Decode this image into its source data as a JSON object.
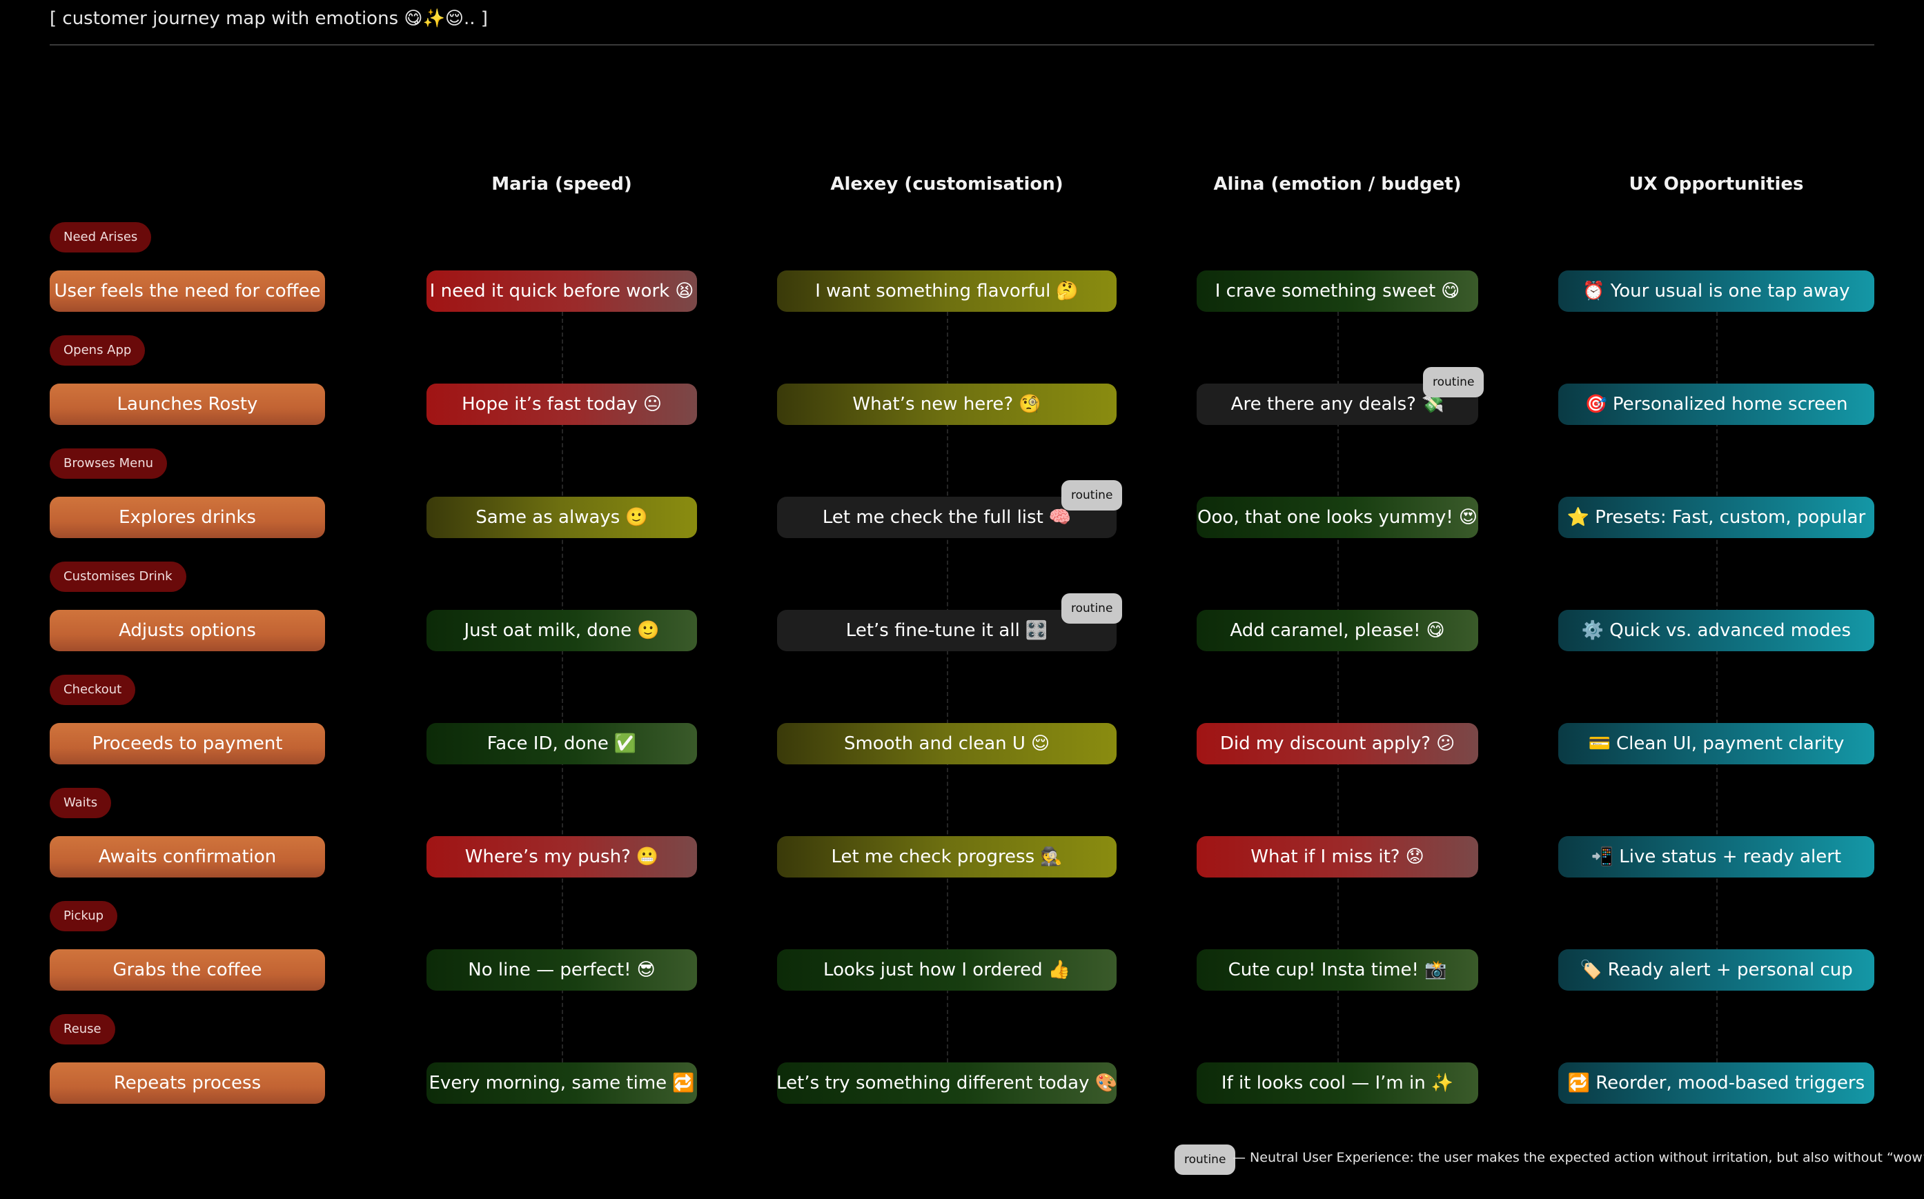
{
  "title": "[ customer journey map with emotions 😋✨😌.. ]",
  "columns": [
    "Maria (speed)",
    "Alexey (customisation)",
    "Alina (emotion / budget)",
    "UX Opportunities"
  ],
  "tag_label": "routine",
  "legend": {
    "tag": "routine",
    "text": "— Neutral User Experience: the user makes the expected action without irritation, but also without “wow”"
  },
  "stages": [
    {
      "stage": "Need Arises",
      "action": "User feels the need for coffee",
      "maria": {
        "text": "I need it quick before work",
        "emoji": "😫",
        "tone": "red"
      },
      "alexey": {
        "text": "I want something flavorful",
        "emoji": "🤔",
        "tone": "yellow"
      },
      "alina": {
        "text": "I crave something sweet",
        "emoji": "😋",
        "tone": "green"
      },
      "ux": {
        "text": "Your usual is one tap away",
        "emoji": "⏰"
      }
    },
    {
      "stage": "Opens App",
      "action": "Launches Rosty",
      "maria": {
        "text": "Hope it’s fast today",
        "emoji": "😐",
        "tone": "red"
      },
      "alexey": {
        "text": "What’s new here?",
        "emoji": "🧐",
        "tone": "yellow"
      },
      "alina": {
        "text": "Are there any deals?",
        "emoji": "💸",
        "tone": "neutral",
        "routine": true
      },
      "ux": {
        "text": "Personalized home screen",
        "emoji": "🎯"
      }
    },
    {
      "stage": "Browses Menu",
      "action": "Explores drinks",
      "maria": {
        "text": "Same as always",
        "emoji": "🙂",
        "tone": "yellow"
      },
      "alexey": {
        "text": "Let me check the full list",
        "emoji": "🧠",
        "tone": "neutral",
        "routine": true
      },
      "alina": {
        "text": "Ooo, that one looks yummy!",
        "emoji": "😍",
        "tone": "green"
      },
      "ux": {
        "text": "Presets: Fast, custom, popular",
        "emoji": "⭐"
      }
    },
    {
      "stage": "Customises Drink",
      "action": "Adjusts options",
      "maria": {
        "text": "Just oat milk, done",
        "emoji": "🙂",
        "tone": "green"
      },
      "alexey": {
        "text": "Let’s fine-tune it all",
        "emoji": "🎛️",
        "tone": "neutral",
        "routine": true
      },
      "alina": {
        "text": "Add caramel, please!",
        "emoji": "😋",
        "tone": "green"
      },
      "ux": {
        "text": "Quick vs. advanced modes",
        "emoji": "⚙️"
      }
    },
    {
      "stage": "Checkout",
      "action": "Proceeds to payment",
      "maria": {
        "text": "Face ID, done",
        "emoji": "✅",
        "tone": "green"
      },
      "alexey": {
        "text": "Smooth and clean U",
        "emoji": "😌",
        "tone": "yellow"
      },
      "alina": {
        "text": "Did my discount apply?",
        "emoji": "😕",
        "tone": "red"
      },
      "ux": {
        "text": "Clean UI, payment clarity",
        "emoji": "💳"
      }
    },
    {
      "stage": "Waits",
      "action": "Awaits confirmation",
      "maria": {
        "text": "Where’s my push?",
        "emoji": "😬",
        "tone": "red"
      },
      "alexey": {
        "text": "Let me check progress",
        "emoji": "🕵️",
        "tone": "yellow"
      },
      "alina": {
        "text": "What if I miss it?",
        "emoji": "😟",
        "tone": "red"
      },
      "ux": {
        "text": "Live status + ready alert",
        "emoji": "📲"
      }
    },
    {
      "stage": "Pickup",
      "action": "Grabs the coffee",
      "maria": {
        "text": "No line — perfect!",
        "emoji": "😎",
        "tone": "green"
      },
      "alexey": {
        "text": "Looks just how I ordered",
        "emoji": "👍",
        "tone": "green"
      },
      "alina": {
        "text": "Cute cup! Insta time!",
        "emoji": "📸",
        "tone": "green"
      },
      "ux": {
        "text": "Ready alert + personal cup",
        "emoji": "🏷️"
      }
    },
    {
      "stage": "Reuse",
      "action": "Repeats process",
      "maria": {
        "text": "Every morning, same time",
        "emoji": "🔁",
        "tone": "green"
      },
      "alexey": {
        "text": "Let’s try something different today",
        "emoji": "🎨",
        "tone": "green"
      },
      "alina": {
        "text": "If it looks cool — I’m in",
        "emoji": "✨",
        "tone": "green"
      },
      "ux": {
        "text": "Reorder, mood-based triggers",
        "emoji": "🔁"
      }
    }
  ]
}
